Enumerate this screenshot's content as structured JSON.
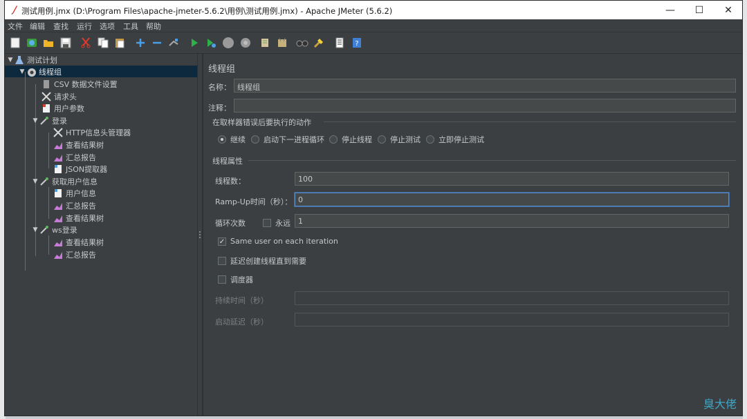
{
  "window": {
    "title": "测试用例.jmx (D:\\Program Files\\apache-jmeter-5.6.2\\用例\\测试用例.jmx) - Apache JMeter (5.6.2)",
    "controls": {
      "minimize": "—",
      "maximize": "☐",
      "close": "✕"
    }
  },
  "menu": [
    "文件",
    "编辑",
    "查找",
    "运行",
    "选项",
    "工具",
    "帮助"
  ],
  "toolbar": [
    "new-icon",
    "templates-icon",
    "open-icon",
    "save-icon",
    "cut-icon",
    "copy-icon",
    "paste-icon",
    "expand-icon",
    "collapse-icon",
    "toggle-icon",
    "start-icon",
    "start-no-pause-icon",
    "stop-icon",
    "shutdown-icon",
    "clear-icon",
    "clear-all-icon",
    "search-icon",
    "reset-search-icon",
    "function-helper-icon",
    "help-icon"
  ],
  "tree": {
    "items": [
      {
        "label": "测试计划",
        "icon": "flask-icon",
        "level": 0
      },
      {
        "label": "线程组",
        "icon": "gear-icon",
        "level": 1,
        "selected": true
      },
      {
        "label": "CSV 数据文件设置",
        "icon": "csv-icon",
        "level": 2
      },
      {
        "label": "请求头",
        "icon": "tools-icon",
        "level": 2
      },
      {
        "label": "用户参数",
        "icon": "doc-icon",
        "level": 2
      },
      {
        "label": "登录",
        "icon": "pipette-icon",
        "level": 2
      },
      {
        "label": "HTTP信息头管理器",
        "icon": "tools-icon",
        "level": 3
      },
      {
        "label": "查看结果树",
        "icon": "chart-icon",
        "level": 3
      },
      {
        "label": "汇总报告",
        "icon": "chart-icon",
        "level": 3
      },
      {
        "label": "JSON提取器",
        "icon": "doc-icon",
        "level": 3
      },
      {
        "label": "获取用户信息",
        "icon": "pipette-icon",
        "level": 2
      },
      {
        "label": "用户信息",
        "icon": "doc-icon",
        "level": 3
      },
      {
        "label": "汇总报告",
        "icon": "chart-icon",
        "level": 3
      },
      {
        "label": "查看结果树",
        "icon": "chart-icon",
        "level": 3
      },
      {
        "label": "ws登录",
        "icon": "pipette-icon",
        "level": 2
      },
      {
        "label": "查看结果树",
        "icon": "chart-icon",
        "level": 3
      },
      {
        "label": "汇总报告",
        "icon": "chart-icon",
        "level": 3
      }
    ]
  },
  "panel": {
    "title": "线程组",
    "name_label": "名称：",
    "name_value": "线程组",
    "comment_label": "注释：",
    "comment_value": "",
    "error_group_title": "在取样器错误后要执行的动作",
    "error_options": [
      {
        "label": "继续",
        "selected": true
      },
      {
        "label": "启动下一进程循环",
        "selected": false
      },
      {
        "label": "停止线程",
        "selected": false
      },
      {
        "label": "停止测试",
        "selected": false
      },
      {
        "label": "立即停止测试",
        "selected": false
      }
    ],
    "props_title": "线程属性",
    "threads_label": "线程数：",
    "threads_value": "100",
    "rampup_label": "Ramp-Up时间（秒）：",
    "rampup_value": "0",
    "loop_label": "循环次数",
    "forever_label": "永远",
    "forever_checked": false,
    "loop_value": "1",
    "same_user_label": "Same user on each iteration",
    "same_user_checked": true,
    "delay_label": "延迟创建线程直到需要",
    "delay_checked": false,
    "scheduler_label": "调度器",
    "scheduler_checked": false,
    "duration_label": "持续时间（秒）",
    "duration_value": "",
    "startup_delay_label": "启动延迟（秒）",
    "startup_delay_value": ""
  },
  "watermark": "臭大佬"
}
